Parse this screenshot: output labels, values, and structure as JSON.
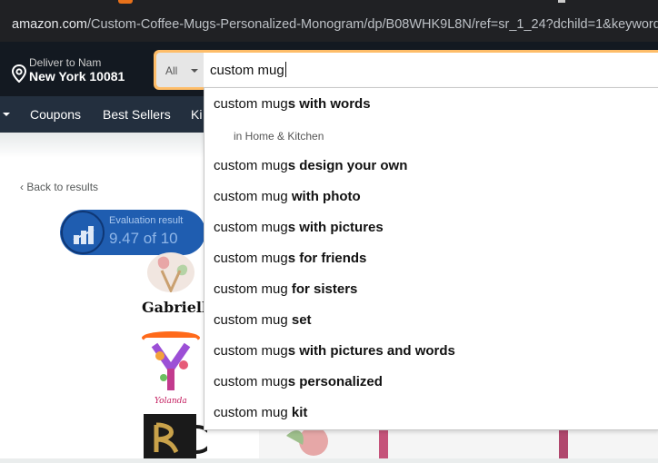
{
  "browser": {
    "url_host": "amazon.com",
    "url_path": "/Custom-Coffee-Mugs-Personalized-Monogram/dp/B08WHK9L8N/ref=sr_1_24?dchild=1&keywords=c"
  },
  "header": {
    "deliver_line1": "Deliver to Nam",
    "deliver_line2": "New York 10081",
    "search_category": "All",
    "search_value": "custom mug"
  },
  "nav": {
    "items": [
      "Coupons",
      "Best Sellers",
      "Ki"
    ]
  },
  "page": {
    "back_link": "‹ Back to results",
    "evaluation": {
      "label": "Evaluation result",
      "score": "9.47 of 10"
    },
    "thumb_names": [
      "Gabriella",
      "Yolanda"
    ]
  },
  "suggestions": [
    {
      "prefix": "custom mug",
      "rest": "s with words"
    },
    {
      "sub": "in Home & Kitchen"
    },
    {
      "prefix": "custom mug",
      "rest": "s design your own"
    },
    {
      "prefix": "custom mug",
      "rest": " with photo"
    },
    {
      "prefix": "custom mug",
      "rest": "s with pictures"
    },
    {
      "prefix": "custom mug",
      "rest": "s for friends"
    },
    {
      "prefix": "custom mug",
      "rest": " for sisters"
    },
    {
      "prefix": "custom mug",
      "rest": " set"
    },
    {
      "prefix": "custom mug",
      "rest": "s with pictures and words"
    },
    {
      "prefix": "custom mug",
      "rest": "s personalized"
    },
    {
      "prefix": "custom mug",
      "rest": " kit"
    }
  ],
  "colors": {
    "amazon_header": "#131921",
    "amazon_nav": "#232f3e",
    "search_focus": "#febd69",
    "eval_badge": "#1f5db0"
  },
  "icons": [
    "location-pin-icon",
    "chevron-down-icon",
    "bar-chart-icon",
    "menu-caret-icon"
  ]
}
